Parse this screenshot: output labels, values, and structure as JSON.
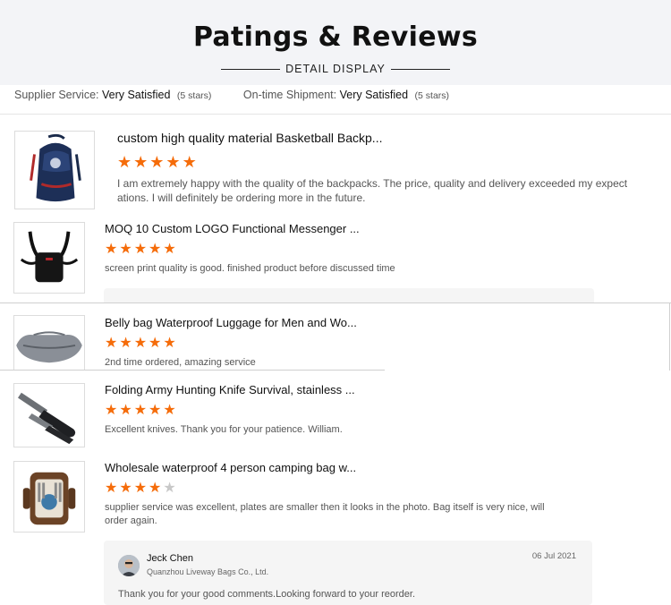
{
  "header": {
    "title": "Patings & Reviews",
    "subtitle": "DETAIL DISPLAY"
  },
  "ratings": [
    {
      "label": "Supplier Service:",
      "value": "Very Satisfied",
      "stars_text": "(5 stars)"
    },
    {
      "label": "On-time Shipment:",
      "value": "Very Satisfied",
      "stars_text": "(5 stars)"
    }
  ],
  "reviews": [
    {
      "title": "custom high quality material Basketball Backp...",
      "rating": 5,
      "text": "I am extremely happy with the quality of the backpacks. The price, quality and delivery exceeded my expect ations. I will definitely be ordering more in the future.",
      "image": "navy-backpack"
    },
    {
      "title": "MOQ 10 Custom LOGO Functional Messenger ...",
      "rating": 5,
      "text": "screen print quality is good. finished product before discussed time",
      "image": "chest-rig-bag"
    },
    {
      "title": "Belly bag Waterproof Luggage for Men and Wo...",
      "rating": 5,
      "text": "2nd time ordered, amazing service",
      "image": "grey-waist-bag"
    },
    {
      "title": "Folding Army Hunting Knife Survival, stainless ...",
      "rating": 5,
      "text": "Excellent knives. Thank you for your patience. William.",
      "image": "folding-knives"
    },
    {
      "title": "Wholesale waterproof 4 person camping bag w...",
      "rating": 4,
      "text": "supplier service was excellent, plates are smaller then it looks in the photo. Bag itself is very nice, will order again.",
      "image": "picnic-backpack"
    }
  ],
  "reply": {
    "name": "Jeck Chen",
    "company": "Quanzhou Liveway Bags Co., Ltd.",
    "date": "06 Jul 2021",
    "message": "Thank you for your good comments.Looking forward to your reorder."
  },
  "colors": {
    "star": "#f56c0a",
    "star_off": "#c8c8c8",
    "header_bg": "#f3f4f7"
  }
}
